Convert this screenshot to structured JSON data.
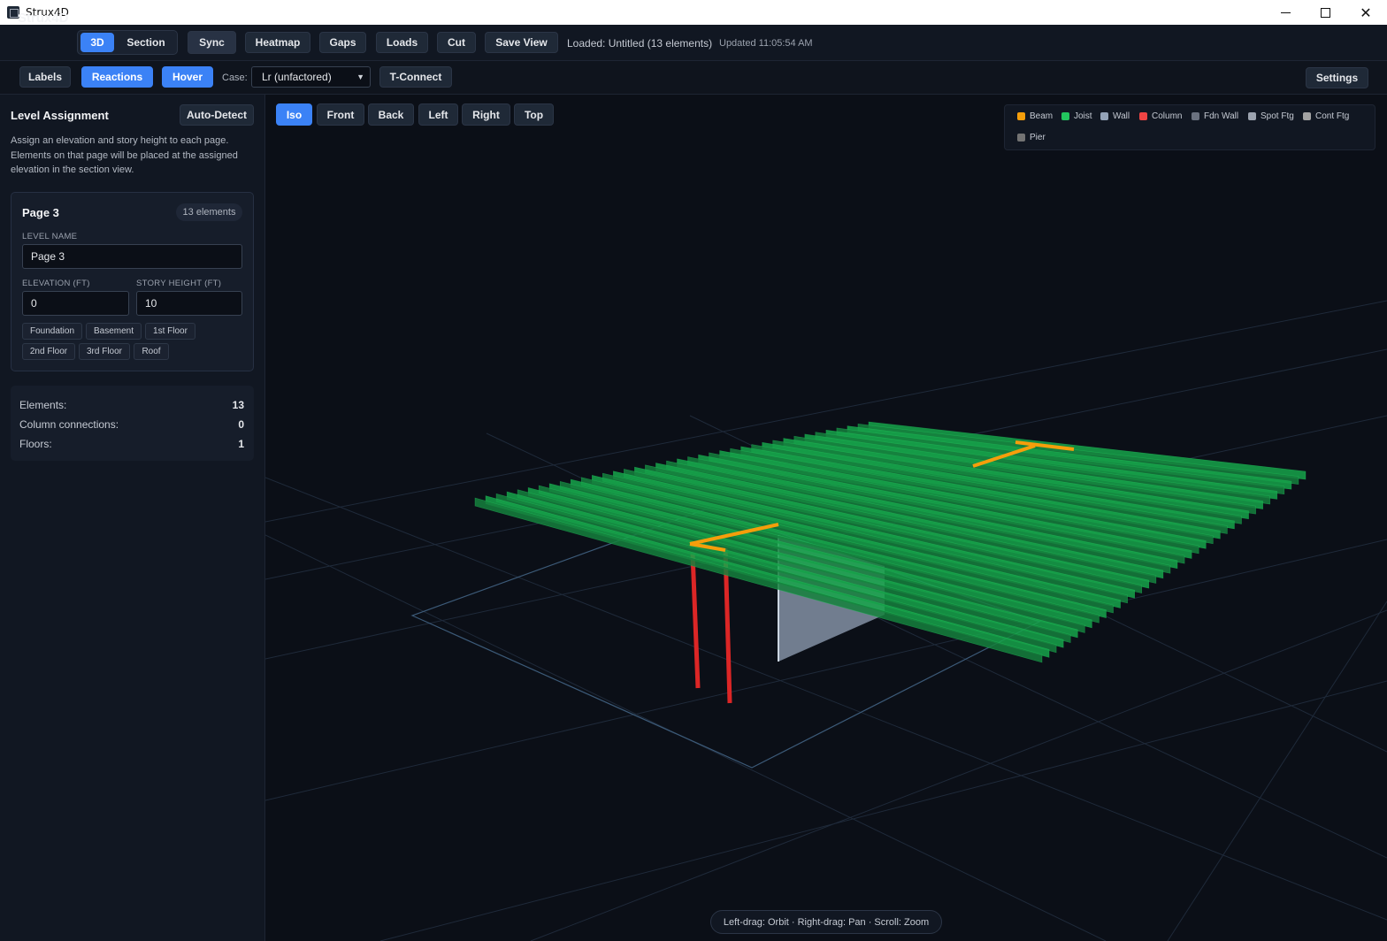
{
  "window": {
    "title": "Strux4D"
  },
  "toolbar": {
    "brand": "Strux4D",
    "mode_3d": "3D",
    "mode_section": "Section",
    "sync": "Sync",
    "heatmap": "Heatmap",
    "gaps": "Gaps",
    "loads": "Loads",
    "cut": "Cut",
    "save_view": "Save View",
    "loaded": "Loaded: Untitled (13 elements)",
    "updated": "Updated 11:05:54 AM"
  },
  "toolbar2": {
    "labels": "Labels",
    "reactions": "Reactions",
    "hover": "Hover",
    "case_label": "Case:",
    "case_value": "Lr (unfactored)",
    "tconnect": "T-Connect",
    "settings": "Settings"
  },
  "sidebar": {
    "title": "Level Assignment",
    "auto_detect": "Auto-Detect",
    "description": "Assign an elevation and story height to each page. Elements on that page will be placed at the assigned elevation in the section view.",
    "card": {
      "title": "Page 3",
      "count": "13 elements",
      "level_name_label": "LEVEL NAME",
      "level_name_value": "Page 3",
      "elevation_label": "ELEVATION (FT)",
      "elevation_value": "0",
      "story_height_label": "STORY HEIGHT (FT)",
      "story_height_value": "10",
      "presets": [
        "Foundation",
        "Basement",
        "1st Floor",
        "2nd Floor",
        "3rd Floor",
        "Roof"
      ]
    },
    "stats": [
      {
        "label": "Elements:",
        "value": "13"
      },
      {
        "label": "Column connections:",
        "value": "0"
      },
      {
        "label": "Floors:",
        "value": "1"
      }
    ]
  },
  "viewport": {
    "views": [
      "Iso",
      "Front",
      "Back",
      "Left",
      "Right",
      "Top"
    ],
    "active_view": "Iso",
    "legend": [
      {
        "label": "Beam",
        "color": "#f59e0b"
      },
      {
        "label": "Joist",
        "color": "#22c55e"
      },
      {
        "label": "Wall",
        "color": "#94a3b8"
      },
      {
        "label": "Column",
        "color": "#ef4444"
      },
      {
        "label": "Fdn Wall",
        "color": "#6b7280"
      },
      {
        "label": "Spot Ftg",
        "color": "#9ca3af"
      },
      {
        "label": "Cont Ftg",
        "color": "#a3a3a3"
      },
      {
        "label": "Pier",
        "color": "#737373"
      }
    ],
    "hint": "Left-drag: Orbit · Right-drag: Pan · Scroll: Zoom"
  }
}
